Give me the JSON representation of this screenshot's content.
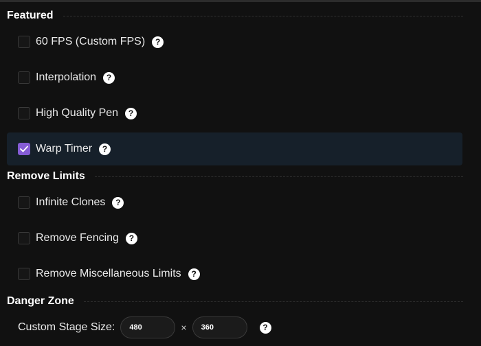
{
  "sections": {
    "featured": {
      "title": "Featured",
      "options": [
        {
          "label": "60 FPS (Custom FPS)",
          "checked": false
        },
        {
          "label": "Interpolation",
          "checked": false
        },
        {
          "label": "High Quality Pen",
          "checked": false
        },
        {
          "label": "Warp Timer",
          "checked": true
        }
      ]
    },
    "remove_limits": {
      "title": "Remove Limits",
      "options": [
        {
          "label": "Infinite Clones",
          "checked": false
        },
        {
          "label": "Remove Fencing",
          "checked": false
        },
        {
          "label": "Remove Miscellaneous Limits",
          "checked": false
        }
      ]
    },
    "danger_zone": {
      "title": "Danger Zone",
      "stage_size": {
        "label": "Custom Stage Size:",
        "width": "480",
        "height": "360",
        "separator": "×"
      }
    }
  },
  "help_glyph": "?",
  "colors": {
    "background": "#111111",
    "accent": "#855cd6",
    "active_row": "#16202a"
  },
  "icons": {
    "help": "question-circle-icon",
    "check": "checkmark-icon"
  }
}
